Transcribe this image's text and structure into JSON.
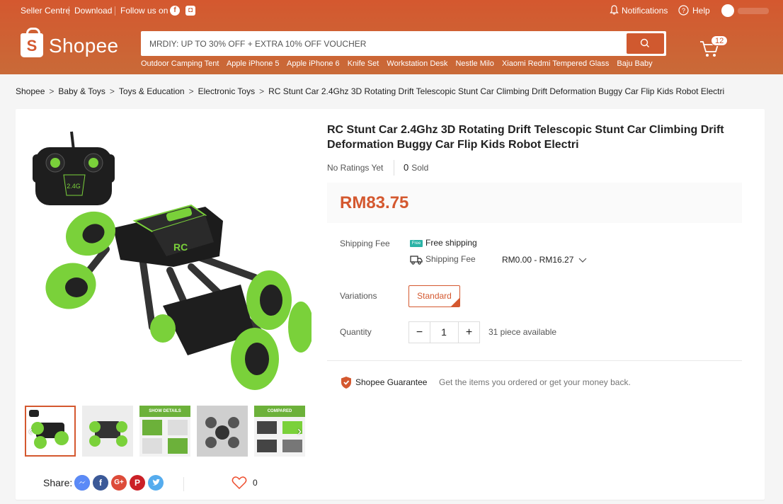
{
  "topbar": {
    "seller_centre": "Seller Centre",
    "download": "Download",
    "follow_us": "Follow us on",
    "notifications": "Notifications",
    "help": "Help"
  },
  "header": {
    "logo_text": "Shopee",
    "logo_letter": "S",
    "search_placeholder": "MRDIY: UP TO 30% OFF + EXTRA 10% OFF VOUCHER",
    "suggestions": [
      "Outdoor Camping Tent",
      "Apple iPhone 5",
      "Apple iPhone 6",
      "Knife Set",
      "Workstation Desk",
      "Nestle Milo",
      "Xiaomi Redmi Tempered Glass",
      "Baju Baby"
    ],
    "cart_count": "12"
  },
  "breadcrumb": [
    "Shopee",
    "Baby & Toys",
    "Toys & Education",
    "Electronic Toys",
    "RC Stunt Car 2.4Ghz 3D Rotating Drift Telescopic Stunt Car Climbing Drift Deformation Buggy Car Flip Kids Robot Electri"
  ],
  "product": {
    "title": "RC Stunt Car 2.4Ghz 3D Rotating Drift Telescopic Stunt Car Climbing Drift Deformation Buggy Car Flip Kids Robot Electri",
    "ratings": "No Ratings Yet",
    "sold_count": "0",
    "sold_label": "Sold",
    "price": "RM83.75",
    "shipping_label": "Shipping Fee",
    "free_shipping": "Free shipping",
    "free_tag": "Free",
    "shipping_fee_label": "Shipping Fee",
    "shipping_fee_range": "RM0.00 - RM16.27",
    "variations_label": "Variations",
    "variation_option": "Standard",
    "quantity_label": "Quantity",
    "quantity_value": "1",
    "available": "31 piece available",
    "remote_label": "2.4G",
    "car_label": "RC"
  },
  "thumbnails": [
    {
      "label": ""
    },
    {
      "label": ""
    },
    {
      "label": "SHOW DETAILS"
    },
    {
      "label": ""
    },
    {
      "label": "COMPARED"
    }
  ],
  "share": {
    "label": "Share:",
    "favorite_count": "0"
  },
  "guarantee": {
    "title": "Shopee Guarantee",
    "text": "Get the items you ordered or get your money back."
  },
  "colors": {
    "brand": "#d4582f",
    "toy_green": "#7ad13a"
  }
}
